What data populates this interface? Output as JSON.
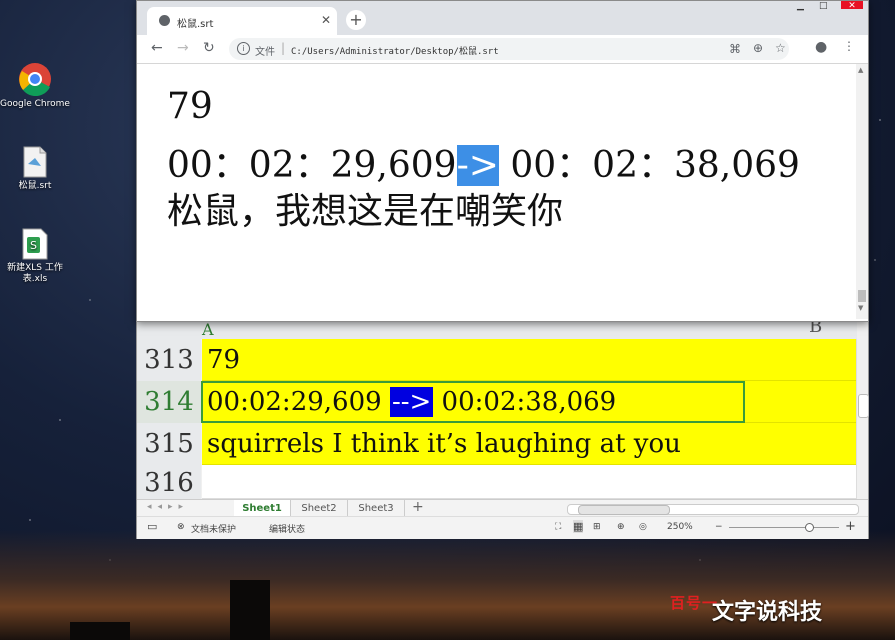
{
  "desktop": {
    "icons": [
      {
        "label": "Google Chrome"
      },
      {
        "label": "松鼠.srt"
      },
      {
        "label": "新建XLS 工作表.xls"
      }
    ]
  },
  "browser": {
    "tab_title": "松鼠.srt",
    "address_scheme": "文件",
    "address_url": "C:/Users/Administrator/Desktop/松鼠.srt",
    "content": {
      "index": "79",
      "time_start": "00：02：29,609",
      "arrow": "->",
      "time_end": " 00：02：38,069",
      "text": "松鼠，我想这是在嘲笑你"
    }
  },
  "spreadsheet": {
    "columns": [
      "A",
      "B"
    ],
    "rows": [
      {
        "num": "313",
        "value": "79"
      },
      {
        "num": "314",
        "time_start": "00:02:29,609 ",
        "arrow": "-->",
        "time_end": " 00:02:38,069"
      },
      {
        "num": "315",
        "value": "squirrels I think it’s laughing at you"
      },
      {
        "num": "316",
        "value": ""
      }
    ],
    "sheet_tabs": [
      "Sheet1",
      "Sheet2",
      "Sheet3"
    ],
    "status": {
      "protect": "文档未保护",
      "mode": "编辑状态",
      "zoom": "250%"
    },
    "colors": {
      "highlight": "#ffff00",
      "arrow_bg": "#0000e0"
    }
  },
  "watermark": {
    "red": "百号一",
    "white": "文字说科技"
  }
}
